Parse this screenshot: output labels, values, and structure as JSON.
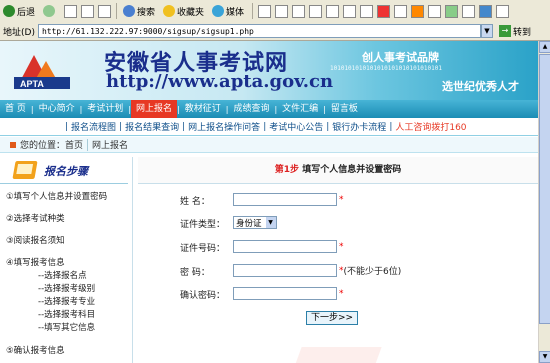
{
  "browser": {
    "toolbar": {
      "back": "后退",
      "search": "搜索",
      "favorites": "收藏夹",
      "media": "媒体"
    },
    "address": {
      "label": "地址(D)",
      "url": "http://61.132.222.97:9000/sigsup/sigsup1.php",
      "go": "转到"
    }
  },
  "header": {
    "title": "安徽省人事考试网",
    "url": "http://www.apta.gov.cn",
    "logo_text": "APTA",
    "slogan1": "创人事考试品牌",
    "slogan2": "选世纪优秀人才",
    "binary": "1010101010101010101010101010101"
  },
  "nav": {
    "items": [
      {
        "label": "首  页"
      },
      {
        "label": "中心简介"
      },
      {
        "label": "考试计划"
      },
      {
        "label": "网上报名"
      },
      {
        "label": "教材征订"
      },
      {
        "label": "成绩查询"
      },
      {
        "label": "文件汇编"
      },
      {
        "label": "留言板"
      }
    ]
  },
  "subnav": {
    "items": [
      {
        "label": "报名流程图"
      },
      {
        "label": "报名结果查询"
      },
      {
        "label": "网上报名操作问答"
      },
      {
        "label": "考试中心公告"
      },
      {
        "label": "银行办卡流程"
      },
      {
        "label": "人工咨询拨打160"
      }
    ]
  },
  "breadcrumb": {
    "prefix": "您的位置：",
    "home": "首页",
    "current": "网上报名"
  },
  "sidebar": {
    "title": "报名步骤",
    "steps": [
      "①填写个人信息并设置密码",
      "②选择考试种类",
      "③阅读报名须知",
      "④填写报考信息"
    ],
    "substeps": [
      "--选择报名点",
      "--选择报考级别",
      "--选择报考专业",
      "--选择报考科目",
      "--填写其它信息"
    ],
    "step5": "⑤确认报考信息"
  },
  "form": {
    "step_num": "第1步",
    "step_title": "填写个人信息并设置密码",
    "name_label": "姓    名：",
    "idtype_label": "证件类型：",
    "idtype_value": "身份证",
    "idnum_label": "证件号码：",
    "password_label": "密    码：",
    "password_hint": "(不能少于6位)",
    "confirm_label": "确认密码：",
    "required": "*",
    "next_button": "下一步>>"
  }
}
